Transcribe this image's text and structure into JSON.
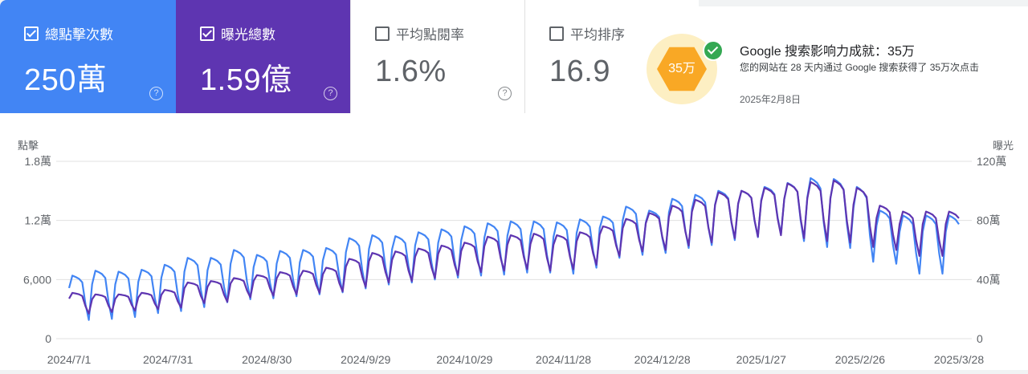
{
  "metrics": {
    "clicks": {
      "label": "總點擊次數",
      "value": "250萬",
      "checked": true
    },
    "impressions": {
      "label": "曝光總數",
      "value": "1.59億",
      "checked": true
    },
    "ctr": {
      "label": "平均點閱率",
      "value": "1.6%",
      "checked": false
    },
    "position": {
      "label": "平均排序",
      "value": "16.9",
      "checked": false
    },
    "help_glyph": "?"
  },
  "achievement": {
    "badge": "35万",
    "title": "Google 搜索影响力成就：35万",
    "description": "您的网站在 28 天内通过 Google 搜索获得了 35万次点击",
    "date": "2025年2月8日"
  },
  "colors": {
    "clicks": "#4285f4",
    "impressions": "#5e35b1",
    "grid": "#e0e0e0",
    "axis_text": "#5f6368"
  },
  "chart_data": {
    "type": "line",
    "ylabel_left": "點擊",
    "ylabel_right": "曝光",
    "left_ticks": [
      "0",
      "6,000",
      "1.2萬",
      "1.8萬"
    ],
    "right_ticks": [
      "0",
      "40萬",
      "80萬",
      "120萬"
    ],
    "ylim_left": [
      0,
      18000
    ],
    "ylim_right": [
      0,
      1200000
    ],
    "x_tick_labels": [
      "2024/7/1",
      "2024/7/31",
      "2024/8/30",
      "2024/9/29",
      "2024/10/29",
      "2024/11/28",
      "2024/12/28",
      "2025/1/27",
      "2025/2/26",
      "2025/3/28"
    ],
    "x_range": [
      "2024/7/1",
      "2025/3/28"
    ],
    "grid": true,
    "series": [
      {
        "name": "總點擊次數",
        "axis": "left",
        "color": "#4285f4",
        "weekly_high": [
          6400,
          6900,
          6800,
          7000,
          7500,
          8200,
          8200,
          9000,
          8500,
          8900,
          9000,
          9200,
          10200,
          10500,
          10400,
          10800,
          11100,
          11400,
          11700,
          11900,
          11900,
          11800,
          12100,
          12400,
          13400,
          13000,
          14200,
          14600,
          15000,
          15000,
          15400,
          15800,
          16300,
          16200,
          15400,
          13000,
          12500
        ],
        "weekly_low": [
          1900,
          2000,
          2200,
          2600,
          2800,
          3200,
          3700,
          4000,
          4100,
          4300,
          4500,
          4700,
          5100,
          5500,
          5700,
          6000,
          6200,
          6400,
          6500,
          6700,
          6700,
          6600,
          7200,
          8200,
          8500,
          8700,
          9200,
          9500,
          10000,
          10300,
          10600,
          9900,
          9300,
          9200,
          7800,
          7600,
          6600
        ]
      },
      {
        "name": "曝光總數",
        "axis": "right",
        "color": "#5e35b1",
        "weekly_high": [
          310000,
          300000,
          300000,
          310000,
          330000,
          380000,
          390000,
          410000,
          430000,
          450000,
          460000,
          480000,
          540000,
          580000,
          590000,
          610000,
          630000,
          650000,
          690000,
          700000,
          710000,
          700000,
          720000,
          760000,
          810000,
          850000,
          900000,
          940000,
          990000,
          1000000,
          1020000,
          1050000,
          1060000,
          1070000,
          1020000,
          900000,
          860000
        ],
        "weekly_low": [
          170000,
          180000,
          190000,
          200000,
          210000,
          240000,
          250000,
          280000,
          290000,
          300000,
          310000,
          320000,
          350000,
          380000,
          390000,
          410000,
          430000,
          450000,
          460000,
          470000,
          460000,
          470000,
          500000,
          560000,
          590000,
          600000,
          630000,
          650000,
          680000,
          690000,
          700000,
          680000,
          660000,
          650000,
          620000,
          600000,
          560000
        ]
      }
    ]
  }
}
